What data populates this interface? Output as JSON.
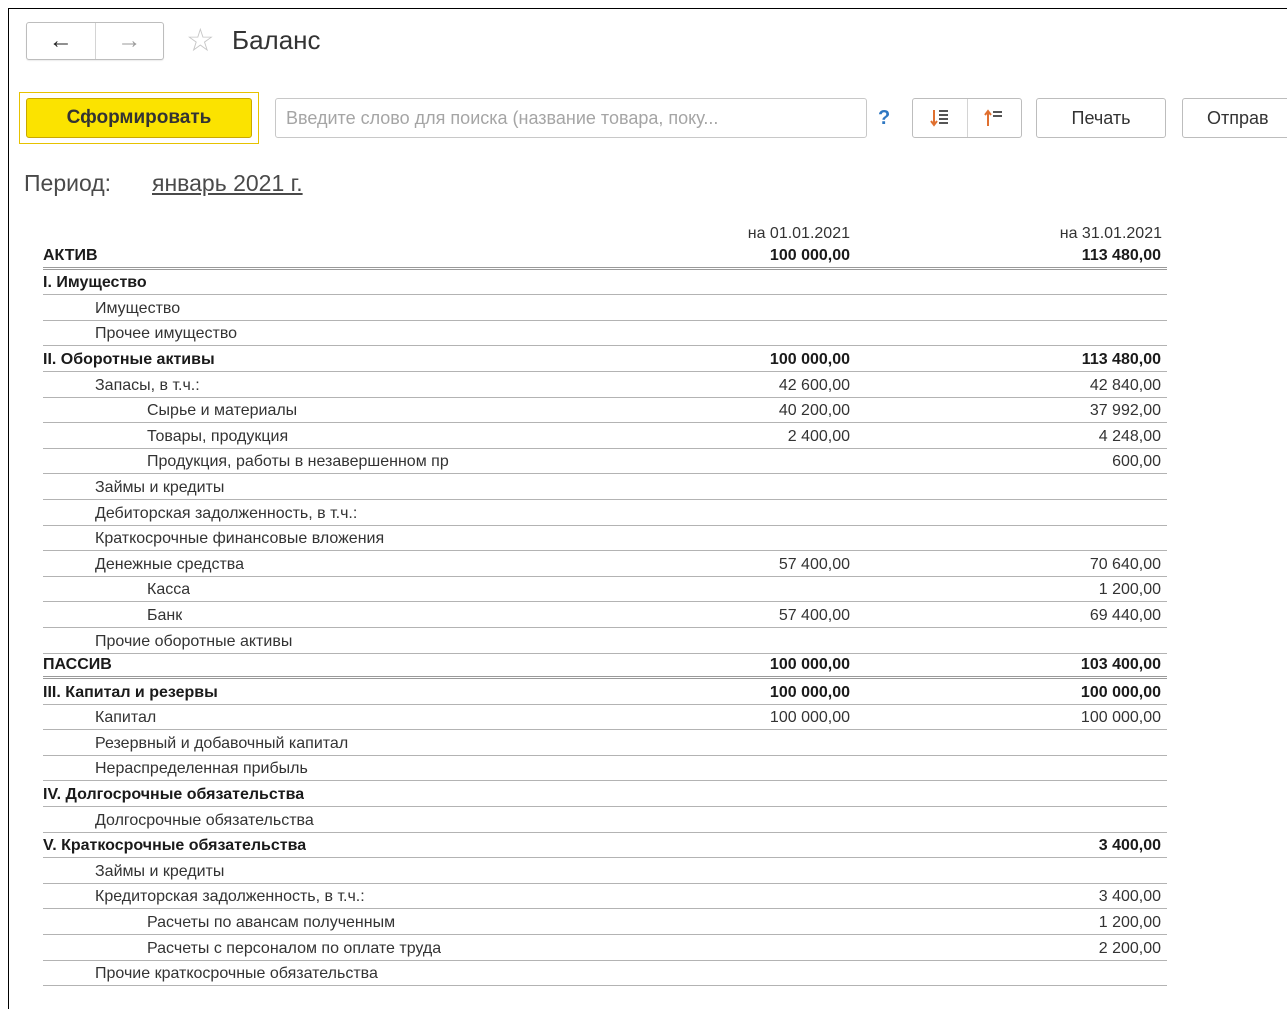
{
  "window": {
    "title": "Баланс",
    "icons": {
      "back": "arrow-left-icon",
      "forward": "arrow-right-icon",
      "favorite": "star-icon"
    }
  },
  "toolbar": {
    "generate_label": "Сформировать",
    "search_placeholder": "Введите слово для поиска (название товара, поку...",
    "help_label": "?",
    "sort_asc_icon": "sort-ascending-icon",
    "sort_desc_icon": "sort-descending-icon",
    "print_label": "Печать",
    "send_label": "Отправ"
  },
  "period": {
    "label": "Период:",
    "value": "январь 2021 г."
  },
  "report": {
    "columns": [
      "на 01.01.2021",
      "на 31.01.2021"
    ],
    "rows": [
      {
        "name": "АКТИВ",
        "v1": "100 000,00",
        "v2": "113 480,00",
        "level": 0,
        "bold": true,
        "double": true
      },
      {
        "name": "I. Имущество",
        "v1": "",
        "v2": "",
        "level": 0,
        "bold": true
      },
      {
        "name": "Имущество",
        "v1": "",
        "v2": "",
        "level": 1
      },
      {
        "name": "Прочее имущество",
        "v1": "",
        "v2": "",
        "level": 1
      },
      {
        "name": "II. Оборотные активы",
        "v1": "100 000,00",
        "v2": "113 480,00",
        "level": 0,
        "bold": true
      },
      {
        "name": "Запасы, в т.ч.:",
        "v1": "42 600,00",
        "v2": "42 840,00",
        "level": 1
      },
      {
        "name": "Сырье и материалы",
        "v1": "40 200,00",
        "v2": "37 992,00",
        "level": 2
      },
      {
        "name": "Товары, продукция",
        "v1": "2 400,00",
        "v2": "4 248,00",
        "level": 2
      },
      {
        "name": "Продукция, работы в незавершенном пр",
        "v1": "",
        "v2": "600,00",
        "level": 2
      },
      {
        "name": "Займы и кредиты",
        "v1": "",
        "v2": "",
        "level": 1
      },
      {
        "name": "Дебиторская задолженность, в т.ч.:",
        "v1": "",
        "v2": "",
        "level": 1
      },
      {
        "name": "Краткосрочные финансовые вложения",
        "v1": "",
        "v2": "",
        "level": 1
      },
      {
        "name": "Денежные средства",
        "v1": "57 400,00",
        "v2": "70 640,00",
        "level": 1
      },
      {
        "name": "Касса",
        "v1": "",
        "v2": "1 200,00",
        "level": 2
      },
      {
        "name": "Банк",
        "v1": "57 400,00",
        "v2": "69 440,00",
        "level": 2
      },
      {
        "name": "Прочие оборотные активы",
        "v1": "",
        "v2": "",
        "level": 1
      },
      {
        "name": "ПАССИВ",
        "v1": "100 000,00",
        "v2": "103 400,00",
        "level": 0,
        "bold": true,
        "double": true
      },
      {
        "name": "III. Капитал и резервы",
        "v1": "100 000,00",
        "v2": "100 000,00",
        "level": 0,
        "bold": true
      },
      {
        "name": "Капитал",
        "v1": "100 000,00",
        "v2": "100 000,00",
        "level": 1
      },
      {
        "name": "Резервный и добавочный капитал",
        "v1": "",
        "v2": "",
        "level": 1
      },
      {
        "name": "Нераспределенная прибыль",
        "v1": "",
        "v2": "",
        "level": 1
      },
      {
        "name": "IV. Долгосрочные обязательства",
        "v1": "",
        "v2": "",
        "level": 0,
        "bold": true
      },
      {
        "name": "Долгосрочные обязательства",
        "v1": "",
        "v2": "",
        "level": 1
      },
      {
        "name": "V. Краткосрочные обязательства",
        "v1": "",
        "v2": "3 400,00",
        "level": 0,
        "bold": true
      },
      {
        "name": "Займы и кредиты",
        "v1": "",
        "v2": "",
        "level": 1
      },
      {
        "name": "Кредиторская задолженность, в т.ч.:",
        "v1": "",
        "v2": "3 400,00",
        "level": 1
      },
      {
        "name": "Расчеты по авансам полученным",
        "v1": "",
        "v2": "1 200,00",
        "level": 2
      },
      {
        "name": "Расчеты с персоналом по оплате труда",
        "v1": "",
        "v2": "2 200,00",
        "level": 2
      },
      {
        "name": "Прочие краткосрочные обязательства",
        "v1": "",
        "v2": "",
        "level": 1
      }
    ]
  }
}
